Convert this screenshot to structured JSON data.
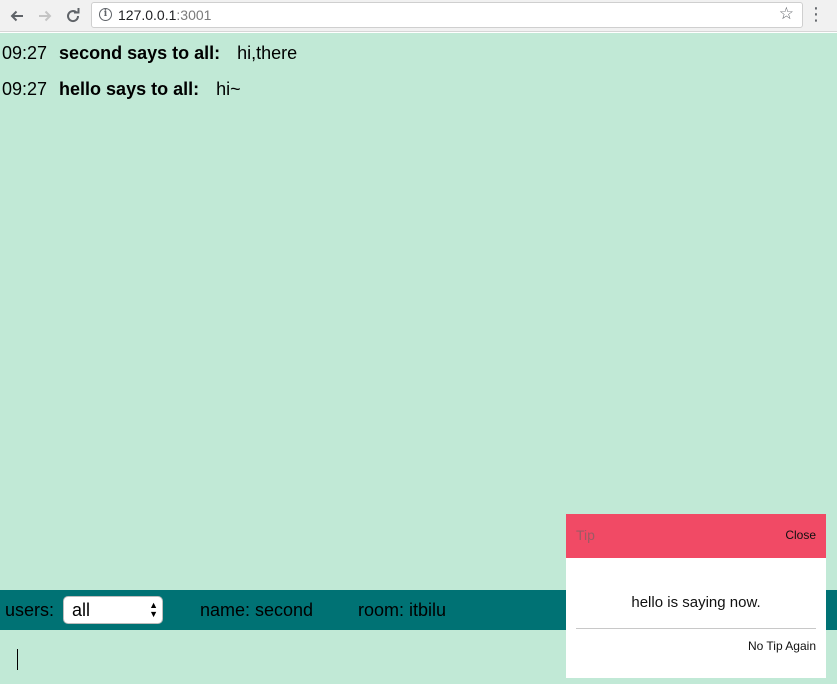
{
  "browser": {
    "url_host": "127.0.0.1",
    "url_port": ":3001",
    "icons": {
      "back": "arrow-left-icon",
      "forward": "arrow-right-icon",
      "reload": "reload-icon",
      "info": "info-icon",
      "bookmark": "star-icon",
      "menu": "kebab-menu-icon"
    }
  },
  "chat": {
    "messages": [
      {
        "time": "09:27",
        "sender": "second says to all:",
        "text": "hi,there"
      },
      {
        "time": "09:27",
        "sender": "hello says to all:",
        "text": "hi~"
      }
    ]
  },
  "status": {
    "users_label": "users:",
    "users_selected": "all",
    "name_text": "name: second",
    "room_text": "room: itbilu"
  },
  "input": {
    "value": ""
  },
  "tip": {
    "title": "Tip",
    "close_label": "Close",
    "message": "hello is saying now.",
    "no_again_label": "No Tip Again"
  },
  "colors": {
    "chat_background": "#c1e9d6",
    "status_bar": "#007274",
    "tip_header": "#f14a65"
  }
}
